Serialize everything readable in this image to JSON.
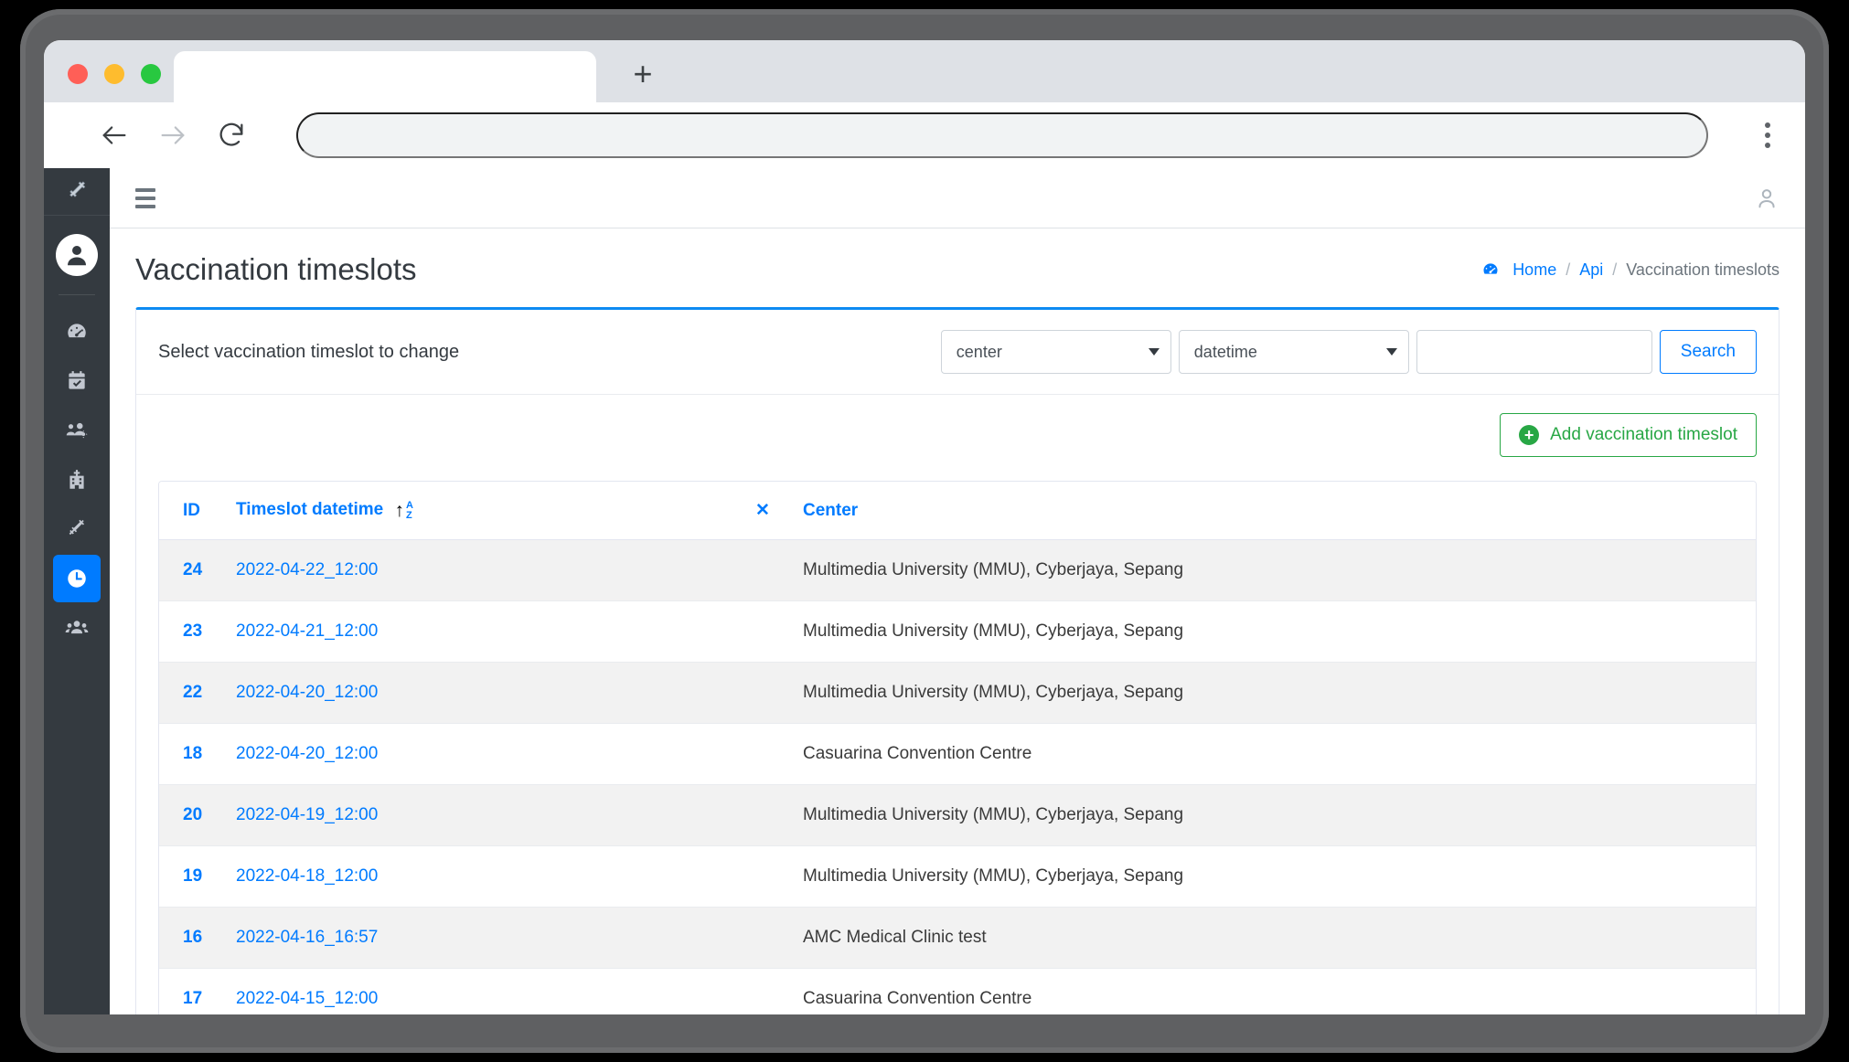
{
  "browser": {
    "tab_title": "",
    "address_value": "",
    "address_placeholder": "",
    "new_tab_label": "+",
    "back_icon": "back-arrow-icon",
    "forward_icon": "forward-arrow-icon",
    "reload_icon": "reload-icon",
    "menu_icon": "kebab-menu-icon"
  },
  "sidebar": {
    "brand_icon": "syringe-icon",
    "avatar_icon": "user-avatar-icon",
    "items": [
      {
        "name": "dashboard",
        "icon": "gauge-icon",
        "active": false
      },
      {
        "name": "appointments",
        "icon": "calendar-check-icon",
        "active": false
      },
      {
        "name": "staff",
        "icon": "users-cog-icon",
        "active": false
      },
      {
        "name": "centers",
        "icon": "hospital-icon",
        "active": false
      },
      {
        "name": "vaccines",
        "icon": "syringe-icon",
        "active": false
      },
      {
        "name": "timeslots",
        "icon": "clock-icon",
        "active": true
      },
      {
        "name": "patients",
        "icon": "users-icon",
        "active": false
      }
    ]
  },
  "topbar": {
    "menu_icon": "hamburger-icon",
    "user_icon": "user-icon"
  },
  "page": {
    "title": "Vaccination timeslots",
    "breadcrumb": {
      "home_icon": "gauge-icon",
      "home": "Home",
      "sep": "/",
      "api": "Api",
      "current": "Vaccination timeslots"
    }
  },
  "filter": {
    "label": "Select vaccination timeslot to change",
    "select_center": "center",
    "select_datetime": "datetime",
    "search_value": "",
    "search_placeholder": "",
    "search_button": "Search"
  },
  "actions": {
    "add_label": "Add vaccination timeslot",
    "add_icon": "plus-circle-icon"
  },
  "table": {
    "columns": {
      "id": "ID",
      "datetime": "Timeslot datetime",
      "clear": "✕",
      "center": "Center"
    },
    "sort_icon": "sort-alpha-asc-icon",
    "rows": [
      {
        "id": "24",
        "datetime": "2022-04-22_12:00",
        "center": "Multimedia University (MMU), Cyberjaya, Sepang"
      },
      {
        "id": "23",
        "datetime": "2022-04-21_12:00",
        "center": "Multimedia University (MMU), Cyberjaya, Sepang"
      },
      {
        "id": "22",
        "datetime": "2022-04-20_12:00",
        "center": "Multimedia University (MMU), Cyberjaya, Sepang"
      },
      {
        "id": "18",
        "datetime": "2022-04-20_12:00",
        "center": "Casuarina Convention Centre"
      },
      {
        "id": "20",
        "datetime": "2022-04-19_12:00",
        "center": "Multimedia University (MMU), Cyberjaya, Sepang"
      },
      {
        "id": "19",
        "datetime": "2022-04-18_12:00",
        "center": "Multimedia University (MMU), Cyberjaya, Sepang"
      },
      {
        "id": "16",
        "datetime": "2022-04-16_16:57",
        "center": "AMC Medical Clinic test"
      },
      {
        "id": "17",
        "datetime": "2022-04-15_12:00",
        "center": "Casuarina Convention Centre"
      }
    ]
  },
  "colors": {
    "accent": "#007bff",
    "card_top_border": "#0d8bf2",
    "sidebar_bg": "#343a40",
    "add_button": "#28a745",
    "row_stripe": "#f2f2f2"
  }
}
